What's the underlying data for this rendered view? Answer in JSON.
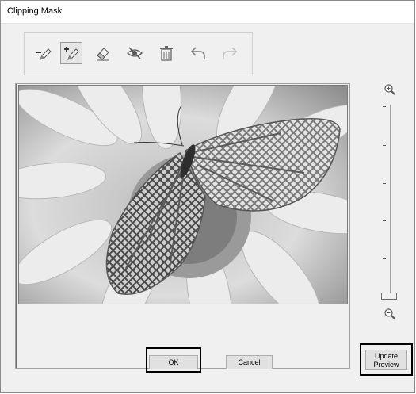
{
  "window": {
    "title": "Clipping Mask"
  },
  "toolbar": {
    "tools": [
      {
        "name": "subtract-mask",
        "icon": "minus-pencil-icon",
        "active": false,
        "enabled": true
      },
      {
        "name": "add-mask",
        "icon": "plus-pencil-icon",
        "active": true,
        "enabled": true
      },
      {
        "name": "eraser",
        "icon": "eraser-icon",
        "active": false,
        "enabled": true
      },
      {
        "name": "hide-mask",
        "icon": "eye-slash-icon",
        "active": false,
        "enabled": true
      },
      {
        "name": "clear",
        "icon": "trash-icon",
        "active": false,
        "enabled": true
      },
      {
        "name": "undo",
        "icon": "undo-arrow-icon",
        "active": false,
        "enabled": true
      },
      {
        "name": "redo",
        "icon": "redo-arrow-icon",
        "active": false,
        "enabled": false
      }
    ]
  },
  "zoom": {
    "in_icon": "zoom-in-icon",
    "out_icon": "zoom-out-icon",
    "level": 0
  },
  "buttons": {
    "update_preview_line1": "Update",
    "update_preview_line2": "Preview",
    "ok_label": "OK",
    "cancel_label": "Cancel"
  },
  "colors": {
    "dialog_bg": "#f0f0f0",
    "mask_overlay": "#3a3a3a",
    "focus_border": "#000000"
  }
}
